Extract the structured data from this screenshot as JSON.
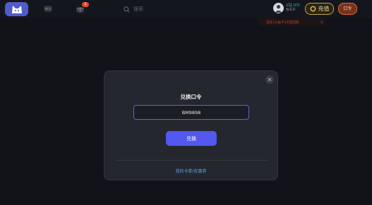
{
  "header": {
    "nav_badge": "1",
    "search_placeholder": "搜索",
    "user": {
      "coins": "1钻 0分",
      "sub": "暂未开"
    },
    "recharge_label": "充值",
    "code_label": "口令"
  },
  "notice": {
    "text": "首充1分由子3天后回顾",
    "close": "×"
  },
  "modal": {
    "title": "兑换口令",
    "input_value": "BM9898",
    "submit_label": "兑换",
    "link_label": "我的卡券/优惠券"
  },
  "colors": {
    "accent": "#5458ee",
    "link": "#5aa2f0",
    "gold": "#c9a23a",
    "danger": "#c8413a"
  }
}
